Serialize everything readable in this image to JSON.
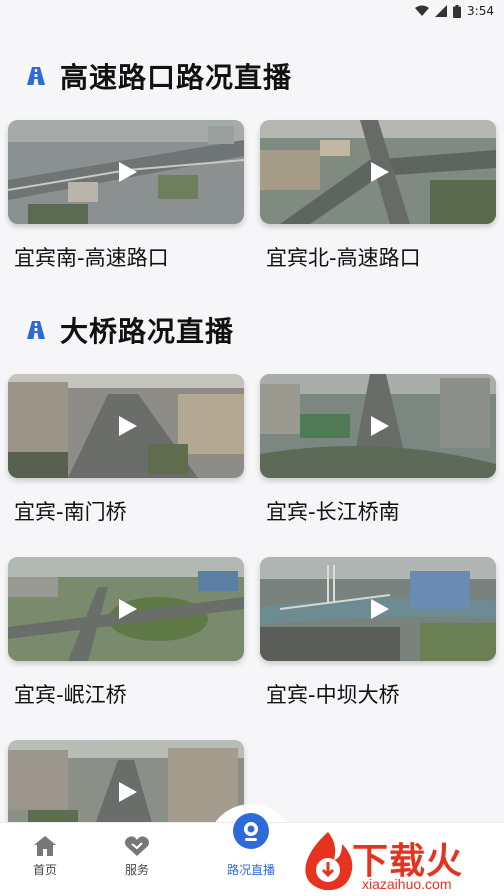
{
  "status_bar": {
    "time": "3:54"
  },
  "sections": [
    {
      "title": "高速路口路况直播",
      "icon": "road-icon"
    },
    {
      "title": "大桥路况直播",
      "icon": "road-icon"
    }
  ],
  "cards": [
    {
      "label": "宜宾南-高速路口",
      "icon": "play-icon"
    },
    {
      "label": "宜宾北-高速路口",
      "icon": "play-icon"
    },
    {
      "label": "宜宾-南门桥",
      "icon": "play-icon"
    },
    {
      "label": "宜宾-长江桥南",
      "icon": "play-icon"
    },
    {
      "label": "宜宾-岷江桥",
      "icon": "play-icon"
    },
    {
      "label": "宜宾-中坝大桥",
      "icon": "play-icon"
    },
    {
      "label": "",
      "icon": "play-icon"
    }
  ],
  "bottom_nav": [
    {
      "label": "首页",
      "icon": "home-icon",
      "active": false
    },
    {
      "label": "服务",
      "icon": "handshake-icon",
      "active": false
    },
    {
      "label": "路况直播",
      "icon": "camera-icon",
      "active": true
    }
  ],
  "watermark": {
    "main": "下载火",
    "sub": "xiazaihuo.com"
  },
  "colors": {
    "accent": "#2f6bd8",
    "watermark": "#e6331f"
  }
}
